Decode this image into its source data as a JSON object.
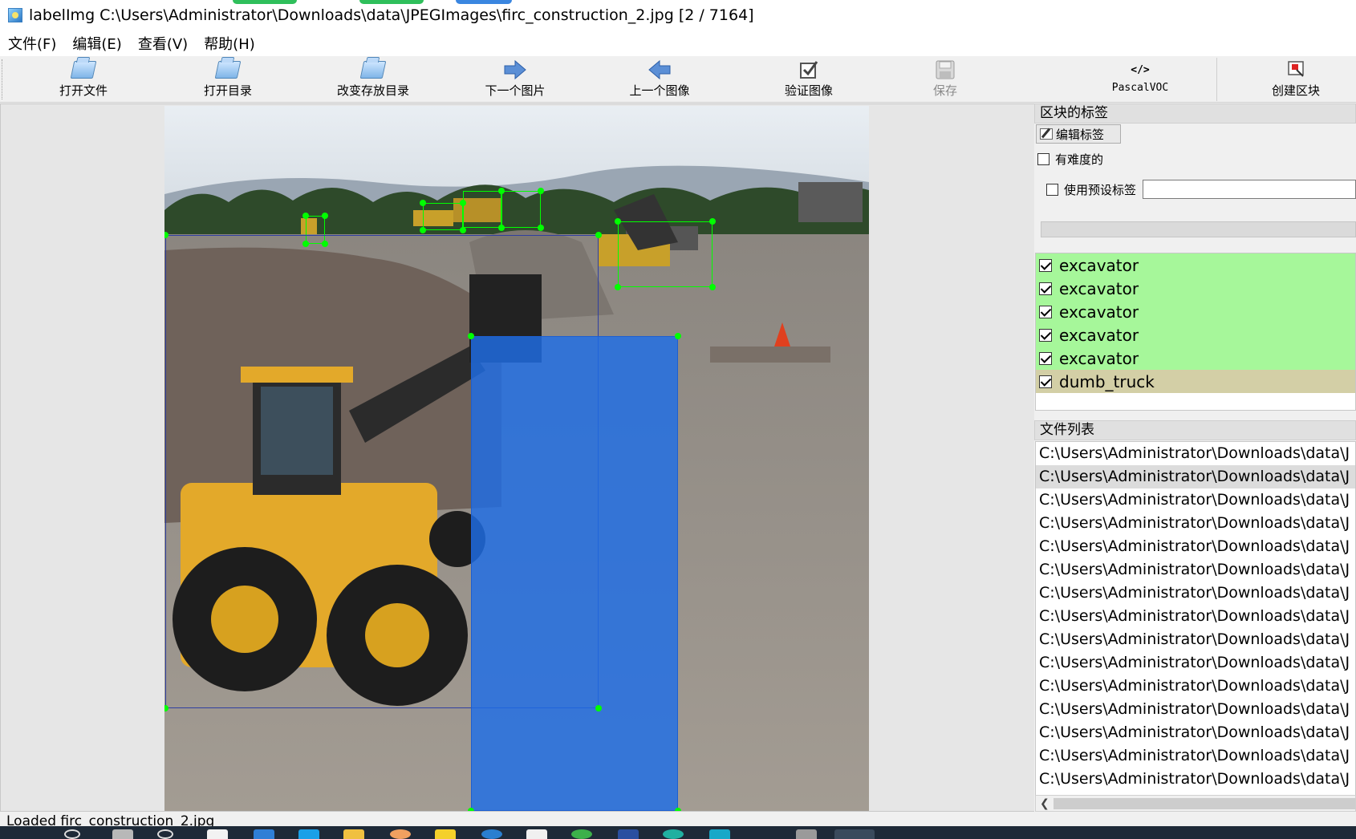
{
  "window": {
    "title": "labelImg C:\\Users\\Administrator\\Downloads\\data\\JPEGImages\\firc_construction_2.jpg [2 / 7164]"
  },
  "menu": [
    "文件(F)",
    "编辑(E)",
    "查看(V)",
    "帮助(H)"
  ],
  "toolbar": {
    "open_file": "打开文件",
    "open_dir": "打开目录",
    "change_save_dir": "改变存放目录",
    "next_image": "下一个图片",
    "prev_image": "上一个图像",
    "verify_image": "验证图像",
    "save": "保存",
    "format": "PascalVOC",
    "format_icon_text": "</>",
    "create_box": "创建区块"
  },
  "icons": {
    "open_file": "folder-icon",
    "open_dir": "folder-icon",
    "change_save_dir": "folder-icon",
    "next_image": "arrow-right-icon",
    "prev_image": "arrow-left-icon",
    "verify_image": "checkbox-icon",
    "save": "floppy-icon",
    "format": "code-icon",
    "create_box": "box-icon"
  },
  "annotations": [
    {
      "label": "excavator",
      "color": "#00ff00"
    },
    {
      "label": "excavator",
      "color": "#00ff00"
    },
    {
      "label": "excavator",
      "color": "#00ff00"
    },
    {
      "label": "excavator",
      "color": "#00ff00"
    },
    {
      "label": "excavator",
      "color": "#00ff00"
    },
    {
      "label": "dumb_truck",
      "color": "#0064ff",
      "selected": true
    }
  ],
  "label_dock": {
    "title": "区块的标签",
    "edit_label_button": "编辑标签",
    "difficult_checkbox": "有难度的",
    "use_preset_checkbox": "使用预设标签",
    "preset_input_value": "",
    "items": [
      {
        "label": "excavator",
        "checked": true,
        "bg": "#a6f79a"
      },
      {
        "label": "excavator",
        "checked": true,
        "bg": "#a6f79a"
      },
      {
        "label": "excavator",
        "checked": true,
        "bg": "#a6f79a"
      },
      {
        "label": "excavator",
        "checked": true,
        "bg": "#a6f79a"
      },
      {
        "label": "excavator",
        "checked": true,
        "bg": "#a6f79a"
      },
      {
        "label": "dumb_truck",
        "checked": true,
        "bg": "#d3cfa6"
      }
    ]
  },
  "file_dock": {
    "title": "文件列表",
    "selected_index": 1,
    "files": [
      "C:\\Users\\Administrator\\Downloads\\data\\J",
      "C:\\Users\\Administrator\\Downloads\\data\\J",
      "C:\\Users\\Administrator\\Downloads\\data\\J",
      "C:\\Users\\Administrator\\Downloads\\data\\J",
      "C:\\Users\\Administrator\\Downloads\\data\\J",
      "C:\\Users\\Administrator\\Downloads\\data\\J",
      "C:\\Users\\Administrator\\Downloads\\data\\J",
      "C:\\Users\\Administrator\\Downloads\\data\\J",
      "C:\\Users\\Administrator\\Downloads\\data\\J",
      "C:\\Users\\Administrator\\Downloads\\data\\J",
      "C:\\Users\\Administrator\\Downloads\\data\\J",
      "C:\\Users\\Administrator\\Downloads\\data\\J",
      "C:\\Users\\Administrator\\Downloads\\data\\J",
      "C:\\Users\\Administrator\\Downloads\\data\\J",
      "C:\\Users\\Administrator\\Downloads\\data\\J"
    ]
  },
  "status": {
    "message": "Loaded firc_construction_2.jpg"
  }
}
